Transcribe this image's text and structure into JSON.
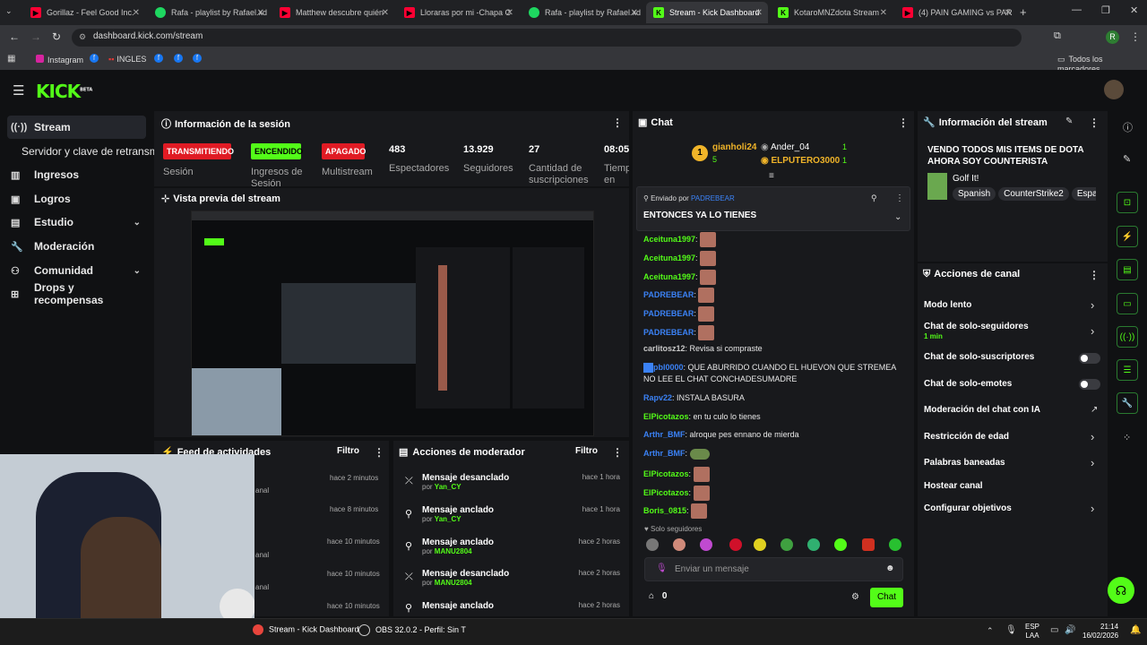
{
  "browser": {
    "tabs": [
      {
        "label": "Gorillaz - Feel Good Inc.",
        "color": "#ff0033",
        "icon": "youtube-icon"
      },
      {
        "label": "Rafa - playlist by Rafael.xd",
        "color": "#1ed760",
        "icon": "spotify-icon"
      },
      {
        "label": "Matthew descubre quién",
        "color": "#ff0033",
        "icon": "youtube-icon"
      },
      {
        "label": "Lloraras por mi -Chapa C",
        "color": "#ff0033",
        "icon": "youtube-icon"
      },
      {
        "label": "Rafa - playlist by Rafael.xd",
        "color": "#1ed760",
        "icon": "spotify-icon"
      },
      {
        "label": "Stream - Kick Dashboard",
        "color": "#53fc18",
        "icon": "kick-icon"
      },
      {
        "label": "KotaroMNZdota Stream",
        "color": "#53fc18",
        "icon": "kick-icon"
      },
      {
        "label": "(4) PAIN GAMING vs PAR",
        "color": "#ff0033",
        "icon": "youtube-icon"
      }
    ],
    "url": "dashboard.kick.com/stream",
    "bookmarks": [
      "Instagram",
      "INGLES"
    ],
    "all_bookmarks": "Todos los marcadores",
    "profile_initial": "R"
  },
  "kick": {
    "logo": "KICK",
    "beta": "BETA"
  },
  "sidebar": {
    "items": [
      {
        "label": "Stream",
        "icon": "stream-icon"
      },
      {
        "label": "Servidor y clave de retransmisión"
      },
      {
        "label": "Ingresos",
        "icon": "revenue-icon"
      },
      {
        "label": "Logros",
        "icon": "achievements-icon"
      },
      {
        "label": "Estudio",
        "icon": "studio-icon"
      },
      {
        "label": "Moderación",
        "icon": "wrench-icon"
      },
      {
        "label": "Comunidad",
        "icon": "community-icon"
      },
      {
        "label": "Drops y recompensas",
        "icon": "drops-icon"
      }
    ]
  },
  "session": {
    "title": "Información de la sesión",
    "badges": [
      {
        "label": "TRANSMITIENDO",
        "sub": "Sesión",
        "bg": "#e01b24"
      },
      {
        "label": "ENCENDIDO",
        "sub": "Ingresos de Sesión",
        "bg": "#53fc18"
      },
      {
        "label": "APAGADO",
        "sub": "Multistream",
        "bg": "#e01b24"
      }
    ],
    "stats": [
      {
        "value": "483",
        "label": "Espectadores"
      },
      {
        "value": "13.929",
        "label": "Seguidores"
      },
      {
        "value": "27",
        "label": "Cantidad de suscripciones"
      },
      {
        "value": "08:05:",
        "label": "Tiempo en vivo"
      }
    ]
  },
  "preview": {
    "title": "Vista previa del stream"
  },
  "feed": {
    "title": "Feed de actividades",
    "filter": "Filtro",
    "times": [
      "hace 2 minutos",
      "hace 8 minutos",
      "hace 10 minutos",
      "hace 10 minutos",
      "hace 10 minutos"
    ],
    "partial": [
      "anal",
      "anal",
      "anal"
    ]
  },
  "modactions": {
    "title": "Acciones de moderador",
    "filter": "Filtro",
    "rows": [
      {
        "action": "Mensaje desanclado",
        "by": "por",
        "user": "Yan_CY",
        "time": "hace 1 hora",
        "icon": "unpin-icon"
      },
      {
        "action": "Mensaje anclado",
        "by": "por",
        "user": "Yan_CY",
        "time": "hace 1 hora",
        "icon": "pin-icon"
      },
      {
        "action": "Mensaje anclado",
        "by": "por",
        "user": "MANU2804",
        "time": "hace 2 horas",
        "icon": "pin-icon"
      },
      {
        "action": "Mensaje desanclado",
        "by": "por",
        "user": "MANU2804",
        "time": "hace 2 horas",
        "icon": "unpin-icon"
      },
      {
        "action": "Mensaje anclado",
        "by": "",
        "user": "",
        "time": "hace 2 horas",
        "icon": "pin-icon"
      }
    ]
  },
  "chat": {
    "title": "Chat",
    "leaderboard": [
      {
        "rank": "1",
        "name": "gianholi24",
        "count": "5"
      },
      {
        "name": "Ander_04",
        "count": "1"
      },
      {
        "name": "ELPUTERO3000",
        "count": "1"
      }
    ],
    "pinned": {
      "by_label": "Enviado por",
      "by_user": "PADREBEAR",
      "text": "ENTONCES YA LO TIENES"
    },
    "messages": [
      {
        "user": "Aceituna1997",
        "color": "#53fc18",
        "text": "",
        "emote": true
      },
      {
        "user": "Aceituna1997",
        "color": "#53fc18",
        "text": "",
        "emote": true
      },
      {
        "user": "Aceituna1997",
        "color": "#53fc18",
        "text": "",
        "emote": true
      },
      {
        "user": "PADREBEAR",
        "color": "#3b82f6",
        "text": "",
        "emote": true
      },
      {
        "user": "PADREBEAR",
        "color": "#3b82f6",
        "text": "",
        "emote": true
      },
      {
        "user": "PADREBEAR",
        "color": "#3b82f6",
        "text": "",
        "emote": true
      },
      {
        "user": "carlitosz12",
        "color": "#c9c9c9",
        "text": "Revisa si compraste",
        "emote": false
      },
      {
        "user": "pbl0000",
        "color": "#3b82f6",
        "text": "QUE ABURRIDO CUANDO EL HUEVON QUE STREMEA NO LEE EL CHAT CONCHADESUMADRE",
        "emote": false
      },
      {
        "user": "Rapv22",
        "color": "#3b82f6",
        "text": "INSTALA BASURA",
        "emote": false
      },
      {
        "user": "ElPicotazos",
        "color": "#53fc18",
        "text": "en tu culo lo tienes",
        "emote": false
      },
      {
        "user": "Arthr_BMF",
        "color": "#3b82f6",
        "text": "alroque pes ennano de mierda",
        "emote": false
      },
      {
        "user": "Arthr_BMF",
        "color": "#3b82f6",
        "text": "",
        "emote": true
      },
      {
        "user": "ElPicotazos",
        "color": "#53fc18",
        "text": "",
        "emote": true
      },
      {
        "user": "ElPicotazos",
        "color": "#53fc18",
        "text": "",
        "emote": true
      },
      {
        "user": "Boris_0815",
        "color": "#53fc18",
        "text": "",
        "emote": true
      }
    ],
    "followers_only": "Solo seguidores",
    "placeholder": "Enviar un mensaje",
    "points": "0",
    "send": "Chat"
  },
  "streaminfo": {
    "title": "Información del stream",
    "stream_title": "VENDO TODOS MIS ITEMS DE DOTA AHORA SOY COUNTERISTA",
    "category": "Golf It!",
    "tags": [
      "Spanish",
      "CounterStrike2",
      "Espa"
    ]
  },
  "channel_actions": {
    "title": "Acciones de canal",
    "items": [
      {
        "label": "Modo lento",
        "type": "chevron"
      },
      {
        "label": "Chat de solo-seguidores",
        "sub": "1 min",
        "type": "chevron"
      },
      {
        "label": "Chat de solo-suscriptores",
        "type": "toggle"
      },
      {
        "label": "Chat de solo-emotes",
        "type": "toggle"
      },
      {
        "label": "Moderación del chat con IA",
        "type": "external"
      },
      {
        "label": "Restricción de edad",
        "type": "chevron"
      },
      {
        "label": "Palabras baneadas",
        "type": "chevron"
      },
      {
        "label": "Hostear canal",
        "type": "none"
      },
      {
        "label": "Configurar objetivos",
        "type": "chevron"
      }
    ]
  },
  "taskbar": {
    "items": [
      "Stream - Kick Dashboard",
      "OBS 32.0.2 - Perfil: Sin T"
    ],
    "lang": "ESP",
    "lang2": "LAA",
    "time": "21:14",
    "date": "16/02/2026"
  }
}
